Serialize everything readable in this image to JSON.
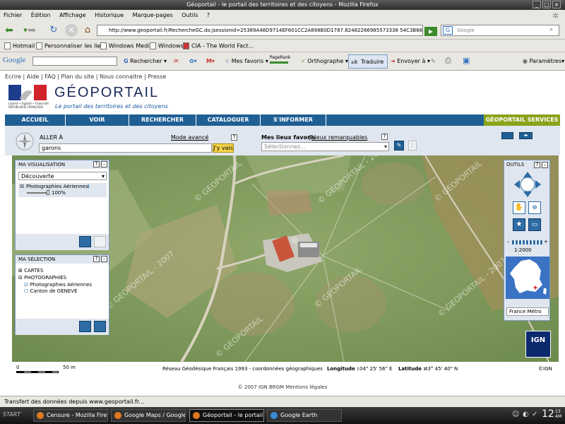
{
  "window": {
    "title": "Géoportail - le portail des territoires et des citoyens - Mozilla Firefox"
  },
  "menu": [
    "Fichier",
    "Édition",
    "Affichage",
    "Historique",
    "Marque-pages",
    "Outils",
    "?"
  ],
  "nav": {
    "url": "http://www.geoportail.fr/RechercheGC.do;jsessionid=25389A48D9714EF601CC2A898B0D1787.82482266985573338 54C3B689",
    "search_placeholder": "Google"
  },
  "bookmarks": [
    "Hotmail",
    "Personnaliser les liens",
    "Windows Media",
    "Windows",
    "CIA - The World Fact..."
  ],
  "gtoolbar": {
    "logo": "Google",
    "rechercher": "Rechercher",
    "favoris": "Mes favoris",
    "pagerank": "PageRank",
    "ortho": "Orthographe",
    "traduire": "Traduire",
    "envoyer": "Envoyer à",
    "parametres": "Paramètres"
  },
  "site": {
    "toplinks": "Ecrire | Aide | FAQ | Plan du site | Nous connaitre | Presse",
    "logo": "GÉOPORTAIL",
    "tagline": "Le portail des territoires et des citoyens",
    "rf_line": "Liberté • Égalité • Fraternité",
    "rf_name": "RÉPUBLIQUE FRANÇAISE",
    "tabs": [
      "ACCUEIL",
      "VOIR",
      "RECHERCHER",
      "CATALOGUER",
      "S'INFORMER",
      "GÉOPORTAIL SERVICES"
    ]
  },
  "search": {
    "label": "ALLER À",
    "advanced": "Mode avancé",
    "help": "?",
    "value": "garons",
    "go": "J'y vais"
  },
  "favorites": {
    "label": "Mes lieux favoris",
    "sep": "|",
    "remarkable": "Lieux remarquables",
    "help": "?",
    "select": "Sélectionnez..."
  },
  "viz": {
    "title": "MA VISUALISATION",
    "dropdown": "Découverte",
    "layer": "Photographies Aériennes",
    "layer_info": "i",
    "opacity": "100%"
  },
  "selection": {
    "title": "MA SÉLECTION",
    "items": [
      {
        "toggle": "⊞",
        "label": "CARTES"
      },
      {
        "toggle": "⊟",
        "label": "PHOTOGRAPHIES"
      }
    ],
    "subitems": [
      {
        "checked": true,
        "label": "Photographies Aériennes"
      },
      {
        "checked": false,
        "label": "Canton de GENEVE"
      }
    ]
  },
  "tools": {
    "title": "OUTILS",
    "scale": "1:2000",
    "region": "France Métro"
  },
  "watermarks": [
    "© GEOPORTAIL",
    "© GEOPORTAIL - 2007",
    "© GEOPORTAIL",
    "© GEOPORTAIL - 2007",
    "© GEOPORTAIL",
    "© GEOPORTAIL - 2007",
    "© GEOPORTAIL"
  ],
  "mapfooter": {
    "scale_zero": "0",
    "scale_dist": "50 m",
    "system": "Réseau Géodésique Français 1993 - coordonnées géographiques",
    "lon_label": "Longitude :",
    "lon": "04° 25' 56\" E",
    "lat_label": "Latitude :",
    "lat": "43° 45' 40\" N",
    "ign": "©IGN"
  },
  "ign_logo": "IGN",
  "copyright": "© 2007 IGN BRGM Mentions légales",
  "status": "Transfert des données depuis www.geoportail.fr...",
  "taskbar": {
    "start": "START",
    "tasks": [
      "Censure - Mozilla Firefox",
      "Google Maps / Google...",
      "Géoportail - le portail ...",
      "Google Earth"
    ],
    "clock_big": "12",
    "clock_small": "13 AM"
  }
}
